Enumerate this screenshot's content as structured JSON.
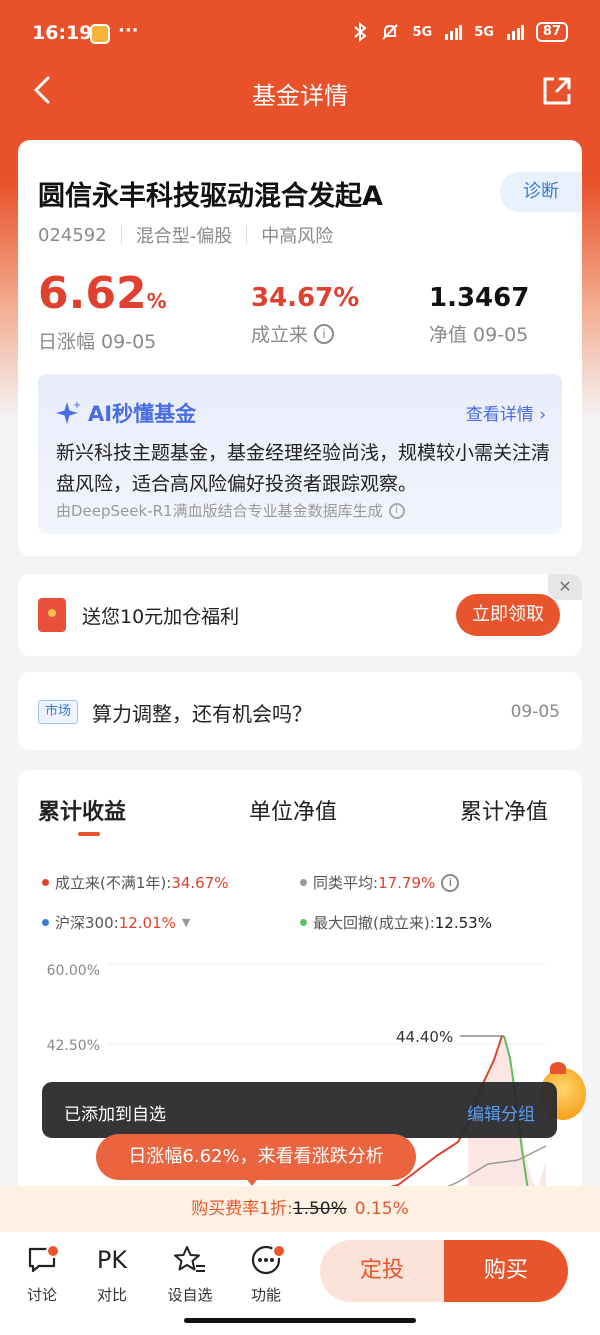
{
  "status_bar": {
    "time": "16:19",
    "dots": "···",
    "net1": "5G",
    "net2": "5G",
    "battery": "87"
  },
  "nav": {
    "title": "基金详情"
  },
  "fund": {
    "name": "圆信永丰科技驱动混合发起A",
    "diag_label": "诊断",
    "code": "024592",
    "type": "混合型-偏股",
    "risk": "中高风险",
    "daily_change": "6.62",
    "daily_change_unit": "%",
    "daily_change_label": "日涨幅 09-05",
    "since_inception": "34.67%",
    "since_inception_label": "成立来",
    "nav_value": "1.3467",
    "nav_label": "净值 09-05"
  },
  "ai": {
    "title": "AI秒懂基金",
    "link": "查看详情",
    "text": "新兴科技主题基金，基金经理经验尚浅，规模较小需关注清盘风险，适合高风险偏好投资者跟踪观察。",
    "source": "由DeepSeek-R1满血版结合专业基金数据库生成"
  },
  "promo": {
    "text": "送您10元加仓福利",
    "button": "立即领取",
    "close": "✕"
  },
  "news": {
    "tag": "市场",
    "title": "算力调整，还有机会吗？",
    "date": "09-05"
  },
  "chart_tabs": [
    "累计收益",
    "单位净值",
    "累计净值"
  ],
  "legend": {
    "item1_label": "成立来(不满1年):",
    "item1_value": "34.67%",
    "item2_label": "同类平均:",
    "item2_value": "17.79%",
    "item3_label": "沪深300:",
    "item3_value": "12.01%",
    "item4_label": "最大回撤(成立来):",
    "item4_value": "12.53%"
  },
  "chart_data": {
    "type": "line",
    "ytick_labels": [
      "60.00%",
      "42.50%"
    ],
    "peak_annotation": "44.40%",
    "series": [
      {
        "name": "成立来(不满1年)",
        "color": "#e0412f"
      },
      {
        "name": "同类平均",
        "color": "#9a9a9a"
      },
      {
        "name": "沪深300",
        "color": "#3a7bd5"
      },
      {
        "name": "最大回撤(成立来)",
        "color": "#5cc05c"
      }
    ]
  },
  "toast": {
    "text": "已添加到自选",
    "link": "编辑分组"
  },
  "bubble": {
    "text": "日涨幅6.62%，来看看涨跌分析"
  },
  "fee": {
    "prefix": "购买费率1折:",
    "old": "1.50%",
    "new": "0.15%"
  },
  "bottom": {
    "tools": [
      "讨论",
      "对比",
      "设自选",
      "功能"
    ],
    "pk": "PK",
    "dingtou": "定投",
    "buy": "购买"
  },
  "colors": {
    "brand": "#e8552d",
    "rise": "#e0412f",
    "ai_blue": "#4a6de6"
  }
}
